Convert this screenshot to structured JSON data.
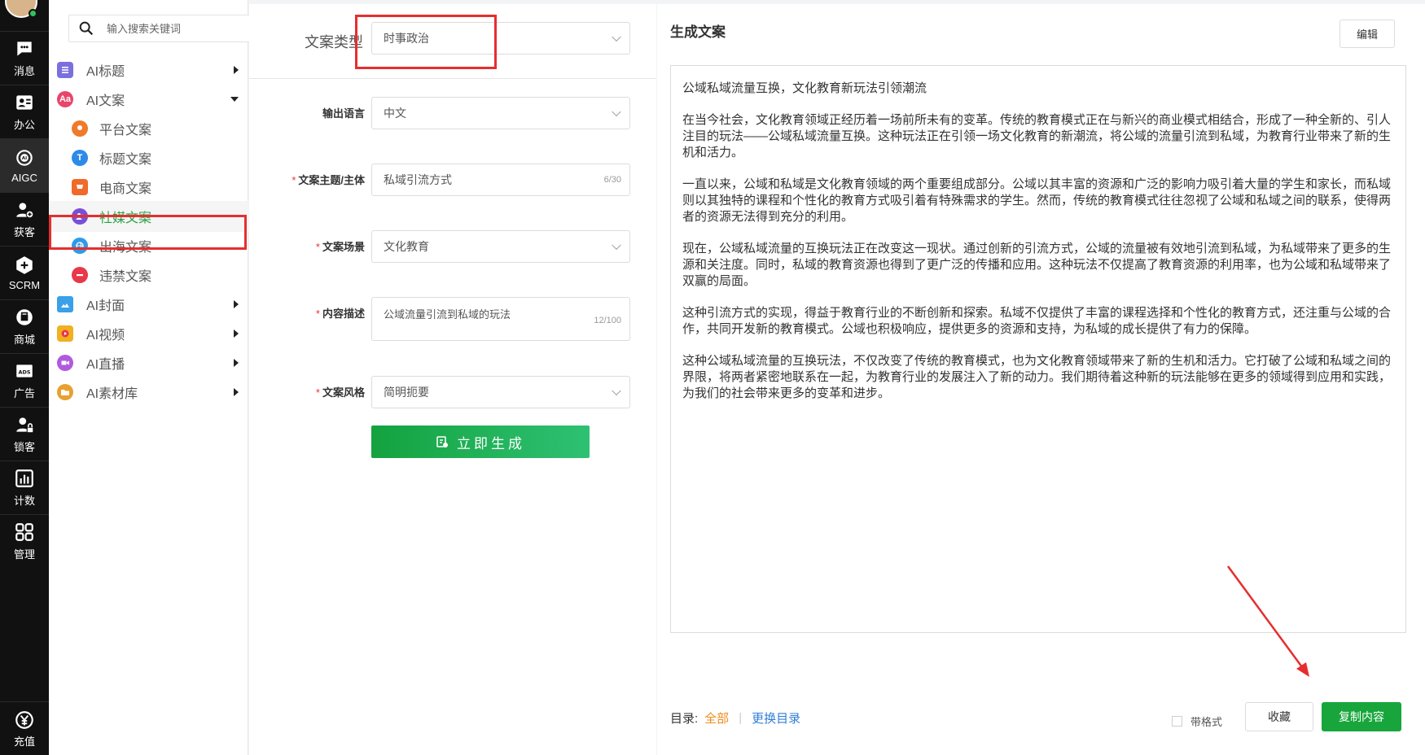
{
  "rail": {
    "items": [
      {
        "label": "消息",
        "icon": "chat-icon"
      },
      {
        "label": "办公",
        "icon": "contact-card-icon"
      },
      {
        "label": "AIGC",
        "icon": "ai-chip-icon"
      },
      {
        "label": "获客",
        "icon": "add-user-icon"
      },
      {
        "label": "SCRM",
        "icon": "scrm-icon"
      },
      {
        "label": "商城",
        "icon": "shop-icon"
      },
      {
        "label": "广告",
        "icon": "ads-icon"
      },
      {
        "label": "锁客",
        "icon": "lock-user-icon"
      },
      {
        "label": "计数",
        "icon": "bar-chart-icon"
      },
      {
        "label": "管理",
        "icon": "grid-icon"
      }
    ],
    "bottom": {
      "label": "充值",
      "icon": "yen-icon"
    }
  },
  "menu": {
    "search_placeholder": "输入搜索关键词",
    "items": [
      {
        "label": "AI标题",
        "color": "#7b6fe0"
      },
      {
        "label": "AI文案",
        "color": "#e8456b",
        "icon_text": "Aa"
      },
      {
        "label": "平台文案",
        "color": "#f07a2a"
      },
      {
        "label": "标题文案",
        "color": "#2d8be8",
        "icon_text": "T"
      },
      {
        "label": "电商文案",
        "color": "#f06a2a"
      },
      {
        "label": "社媒文案",
        "color": "#7a4fd6"
      },
      {
        "label": "出海文案",
        "color": "#2d9be8"
      },
      {
        "label": "违禁文案",
        "color": "#e8384a"
      },
      {
        "label": "AI封面",
        "color": "#3aa0e8"
      },
      {
        "label": "AI视频",
        "color": "#f0b020"
      },
      {
        "label": "AI直播",
        "color": "#b05ae0"
      },
      {
        "label": "AI素材库",
        "color": "#e8a030"
      }
    ]
  },
  "form": {
    "type_label": "文案类型",
    "type_value": "时事政治",
    "lang_label": "输出语言",
    "lang_value": "中文",
    "subject_label": "文案主题/主体",
    "subject_value": "私域引流方式",
    "subject_count": "6/30",
    "scene_label": "文案场景",
    "scene_value": "文化教育",
    "desc_label": "内容描述",
    "desc_value": "公域流量引流到私域的玩法",
    "desc_count": "12/100",
    "style_label": "文案风格",
    "style_value": "简明扼要",
    "required_mark": "*",
    "generate_label": "立即生成"
  },
  "output": {
    "title": "生成文案",
    "edit_label": "编辑",
    "paragraphs": [
      "公域私域流量互换，文化教育新玩法引领潮流",
      "在当今社会，文化教育领域正经历着一场前所未有的变革。传统的教育模式正在与新兴的商业模式相结合，形成了一种全新的、引人注目的玩法——公域私域流量互换。这种玩法正在引领一场文化教育的新潮流，将公域的流量引流到私域，为教育行业带来了新的生机和活力。",
      "一直以来，公域和私域是文化教育领域的两个重要组成部分。公域以其丰富的资源和广泛的影响力吸引着大量的学生和家长，而私域则以其独特的课程和个性化的教育方式吸引着有特殊需求的学生。然而，传统的教育模式往往忽视了公域和私域之间的联系，使得两者的资源无法得到充分的利用。",
      "现在，公域私域流量的互换玩法正在改变这一现状。通过创新的引流方式，公域的流量被有效地引流到私域，为私域带来了更多的生源和关注度。同时，私域的教育资源也得到了更广泛的传播和应用。这种玩法不仅提高了教育资源的利用率，也为公域和私域带来了双赢的局面。",
      "这种引流方式的实现，得益于教育行业的不断创新和探索。私域不仅提供了丰富的课程选择和个性化的教育方式，还注重与公域的合作，共同开发新的教育模式。公域也积极响应，提供更多的资源和支持，为私域的成长提供了有力的保障。",
      "这种公域私域流量的互换玩法，不仅改变了传统的教育模式，也为文化教育领域带来了新的生机和活力。它打破了公域和私域之间的界限，将两者紧密地联系在一起，为教育行业的发展注入了新的动力。我们期待着这种新的玩法能够在更多的领域得到应用和实践，为我们的社会带来更多的变革和进步。"
    ],
    "toc_label": "目录:",
    "toc_all": "全部",
    "toc_separator": "|",
    "toc_change": "更换目录",
    "format_label": "带格式",
    "favorite_label": "收藏",
    "copy_label": "复制内容"
  }
}
